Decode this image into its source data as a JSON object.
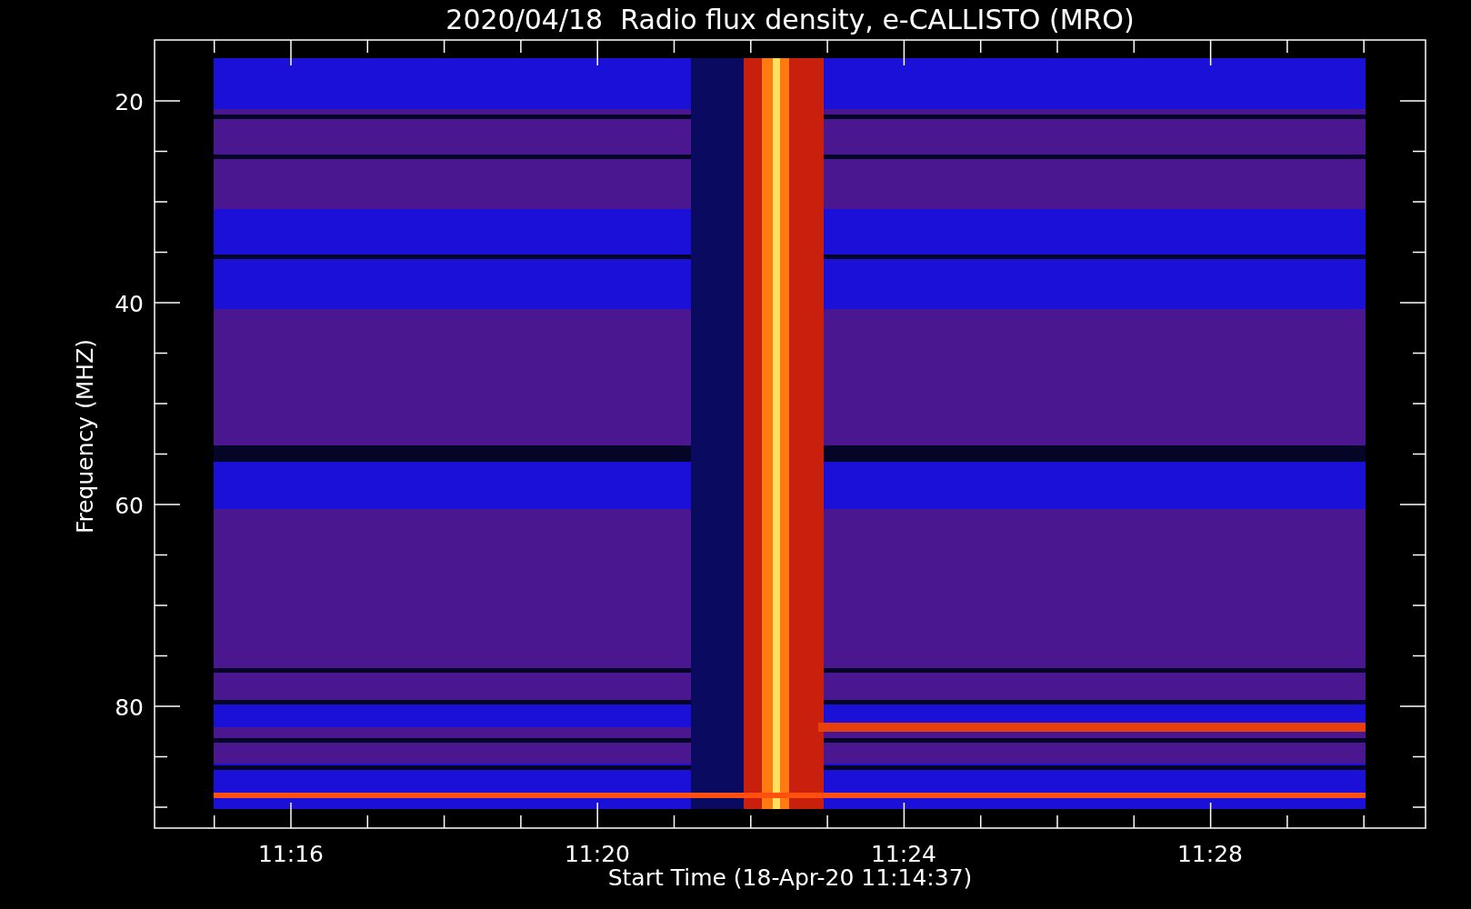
{
  "title": "2020/04/18  Radio flux density, e-CALLISTO (MRO)",
  "y_axis": {
    "label": "Frequency (MHZ)",
    "ticks": [
      "20",
      "40",
      "60",
      "80"
    ]
  },
  "x_axis": {
    "label": "Start Time (18-Apr-20 11:14:37)",
    "ticks": [
      "11:16",
      "11:20",
      "11:24",
      "11:28"
    ]
  }
}
